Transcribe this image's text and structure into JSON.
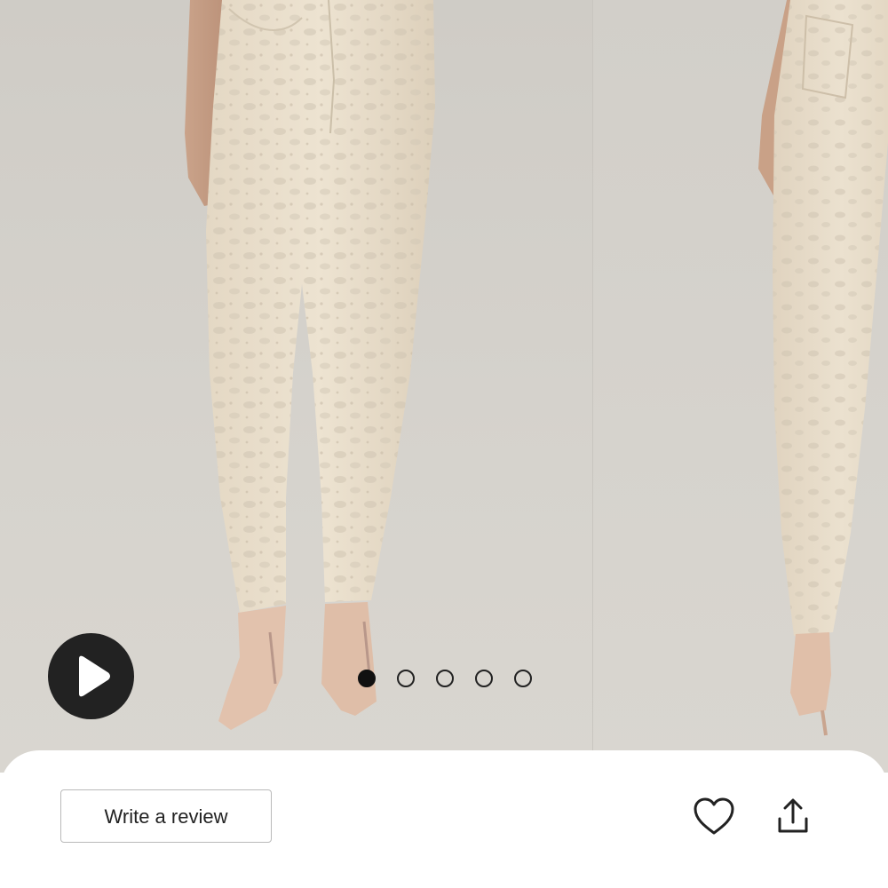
{
  "gallery": {
    "main_image_icon": "product-photo-front",
    "next_image_icon": "product-photo-back",
    "play_icon": "play-icon",
    "dots": [
      {
        "active": true
      },
      {
        "active": false
      },
      {
        "active": false
      },
      {
        "active": false
      },
      {
        "active": false
      }
    ]
  },
  "actions": {
    "review_label": "Write a review",
    "wishlist_icon": "heart-icon",
    "share_icon": "share-icon"
  },
  "colors": {
    "background": "#d4d1cb",
    "trousers": "#e8dcc8",
    "shoes": "#e2c2ad",
    "play_button": "#222222",
    "sheet": "#ffffff"
  }
}
